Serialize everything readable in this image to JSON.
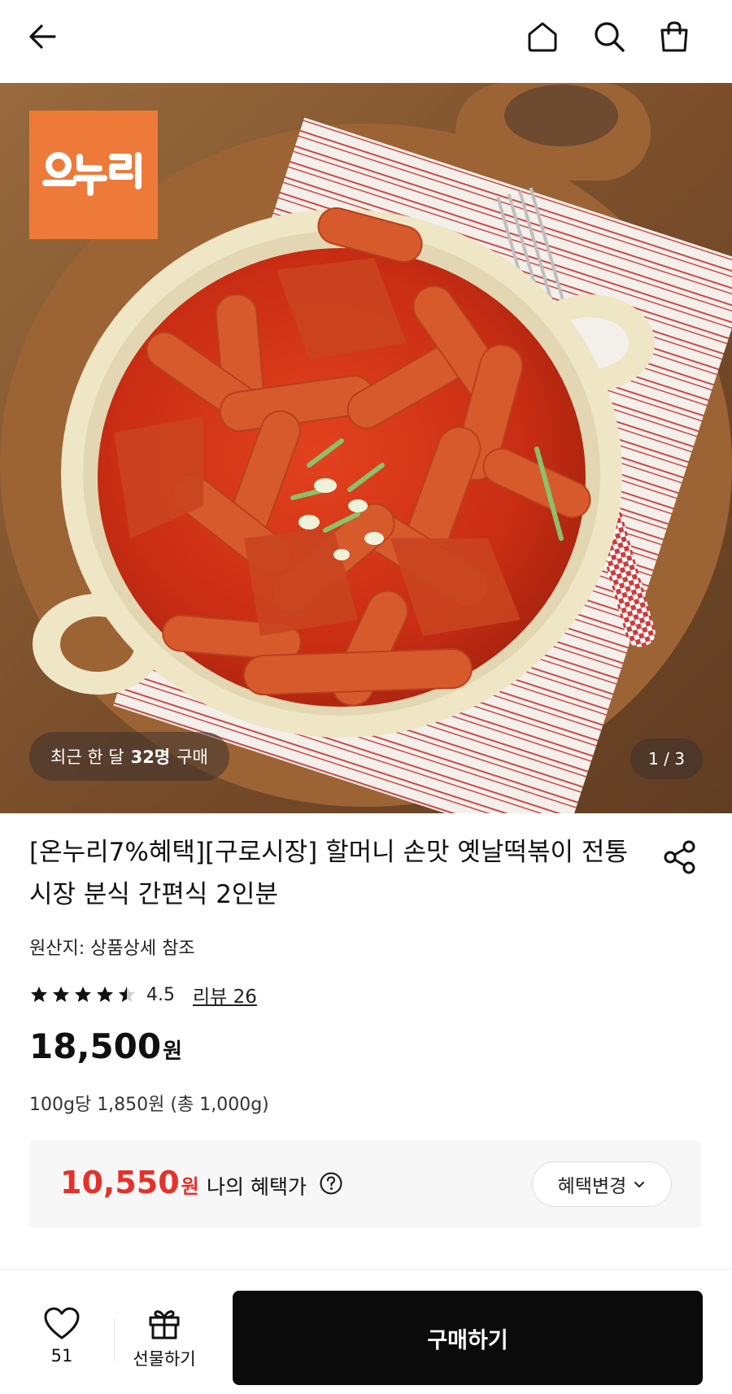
{
  "nav": {
    "icons": [
      "back-arrow-icon",
      "home-icon",
      "search-icon",
      "shopping-bag-icon"
    ]
  },
  "hero": {
    "brand_logo_text": "온누리",
    "purchase_prefix": "최근 한 달",
    "purchase_count": "32명",
    "purchase_suffix": "구매",
    "page_indicator": "1 / 3"
  },
  "product": {
    "title": "[온누리7%혜택][구로시장] 할머니 손맛 옛날떡볶이 전통시장 분식 간편식 2인분",
    "origin": "원산지: 상품상세 참조",
    "rating": 4.5,
    "rating_text": "4.5",
    "review_link": "리뷰 26",
    "price": "18,500",
    "currency": "원",
    "unit_price": "100g당 1,850원 (총 1,000g)"
  },
  "benefit": {
    "price": "10,550",
    "currency": "원",
    "label": "나의 혜택가",
    "change_button": "혜택변경"
  },
  "bottom": {
    "like_count": "51",
    "gift_label": "선물하기",
    "buy_label": "구매하기"
  },
  "colors": {
    "accent_red": "#e4322b",
    "buy_button": "#0b0b0b",
    "brand_orange": "#ee7a3a"
  }
}
